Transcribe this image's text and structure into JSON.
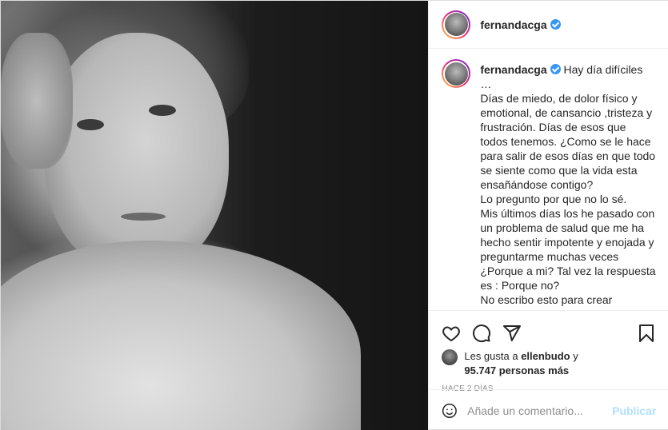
{
  "header": {
    "username": "fernandacga",
    "verified_icon": "verified-badge-icon",
    "more_icon": "more-options-icon",
    "more_label": "···"
  },
  "caption": {
    "username": "fernandacga",
    "text": " Hay día difíciles …\nDías de miedo, de dolor físico y emotional, de cansancio ,tristeza y frustración. Días de esos que todos tenemos. ¿Como se le hace para salir de esos días en que todo se siente como que la vida esta ensañándose contigo?\nLo pregunto por que no lo sé.\nMis últimos días los he pasado con un problema de salud que me ha hecho sentir impotente y enojada y preguntarme muchas veces ¿Porque a mi? Tal vez la respuesta es : Porque no?\nNo escribo esto para crear preocupación ( no es covid ,ni nada que ver con mi postparto) ni para recibir aliento (aunque siempre"
  },
  "actions": {
    "like_icon": "heart-icon",
    "comment_icon": "comment-icon",
    "share_icon": "share-icon",
    "save_icon": "bookmark-icon"
  },
  "likes": {
    "prefix": "Les gusta a ",
    "user": "ellenbudo",
    "conj": " y",
    "count": "95.747 personas más"
  },
  "time": "HACE 2 DÍAS",
  "comment": {
    "emoji_icon": "smiley-icon",
    "placeholder": "Añade un comentario...",
    "post_label": "Publicar"
  },
  "colors": {
    "verified": "#3897f0",
    "publish_disabled": "#b2dffc",
    "meta": "#8e8e8e",
    "text": "#262626"
  }
}
